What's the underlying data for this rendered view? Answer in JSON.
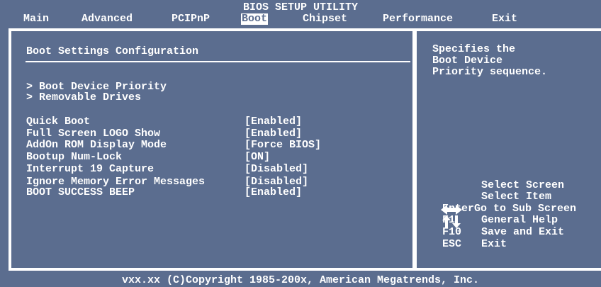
{
  "header": {
    "title": "BIOS SETUP UTILITY",
    "tabs": [
      {
        "label": "Main"
      },
      {
        "label": "Advanced"
      },
      {
        "label": "PCIPnP"
      },
      {
        "label": "Boot"
      },
      {
        "label": "Chipset"
      },
      {
        "label": "Performance"
      },
      {
        "label": "Exit"
      }
    ],
    "active_tab": "Boot"
  },
  "main": {
    "section_title": "Boot Settings Configuration",
    "submenus": [
      {
        "label": "> Boot Device Priority"
      },
      {
        "label": "> Removable Drives"
      }
    ],
    "settings": [
      {
        "label": "Quick Boot",
        "value": "[Enabled]"
      },
      {
        "label": "Full Screen LOGO Show",
        "value": "[Enabled]"
      },
      {
        "label": "AddOn ROM Display Mode",
        "value": "[Force BIOS]"
      },
      {
        "label": "Bootup Num-Lock",
        "value": "[ON]"
      },
      {
        "label": "Interrupt 19 Capture",
        "value": "[Disabled]"
      },
      {
        "label": "Ignore Memory Error Messages",
        "value": "[Disabled]"
      },
      {
        "label": "BOOT SUCCESS BEEP",
        "value": "[Enabled]"
      }
    ]
  },
  "help": {
    "lines": [
      "Specifies the",
      "Boot Device",
      "Priority sequence."
    ],
    "keys": [
      {
        "key": "",
        "icon": "left-right-arrows-icon",
        "desc": "Select Screen"
      },
      {
        "key": "",
        "icon": "up-down-arrows-icon",
        "desc": "Select Item"
      },
      {
        "key": "Enter",
        "desc": "Go to Sub Screen"
      },
      {
        "key": "F1",
        "desc": "General Help"
      },
      {
        "key": "F10",
        "desc": "Save and Exit"
      },
      {
        "key": "ESC",
        "desc": "Exit"
      }
    ]
  },
  "footer": {
    "text": "vxx.xx (C)Copyright 1985-200x, American Megatrends, Inc."
  },
  "colors": {
    "background": "#5b6d8f",
    "foreground": "#ffffff"
  }
}
